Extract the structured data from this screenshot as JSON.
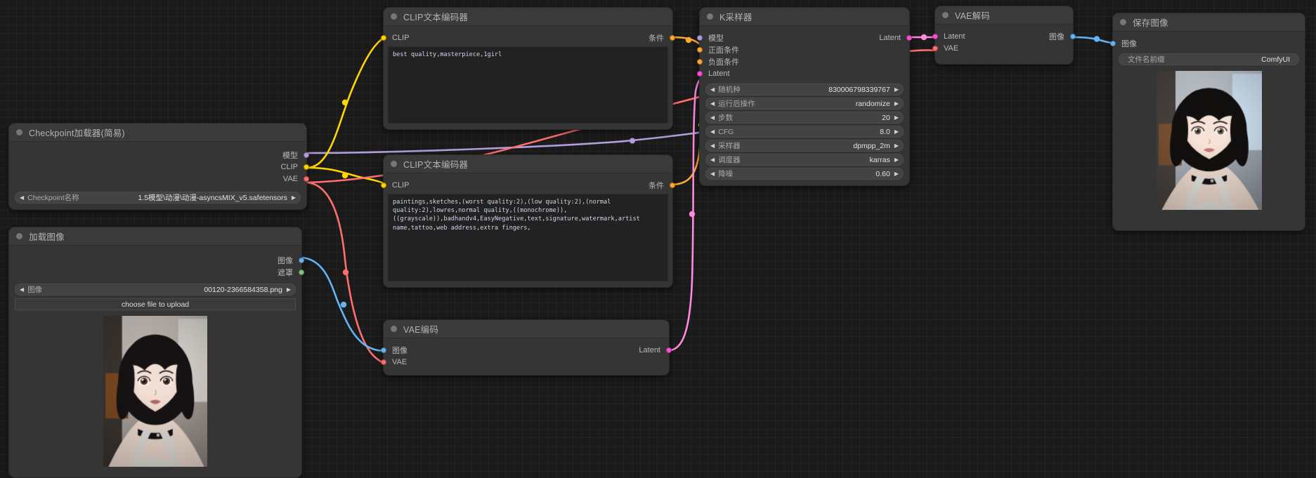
{
  "app": {
    "name": "ComfyUI",
    "canvas_background": "#1a1a1a"
  },
  "colors": {
    "model": "#b39ddb",
    "clip": "#ffd500",
    "vae": "#ff6e6e",
    "conditioning": "#ffa931",
    "latent": "#ff4fd8",
    "image": "#64b5f6",
    "mask": "#81c784"
  },
  "nodes": {
    "checkpoint_loader": {
      "title": "Checkpoint加载器(简易)",
      "outputs": [
        {
          "label": "模型",
          "type": "model"
        },
        {
          "label": "CLIP",
          "type": "clip"
        },
        {
          "label": "VAE",
          "type": "vae"
        }
      ],
      "widgets": [
        {
          "name": "Checkpoint名称",
          "value": "1.5模型\\动漫\\动漫-asyncsMIX_v5.safetensors"
        }
      ]
    },
    "load_image": {
      "title": "加载图像",
      "outputs": [
        {
          "label": "图像",
          "type": "image"
        },
        {
          "label": "遮罩",
          "type": "mask"
        }
      ],
      "widgets": [
        {
          "name": "图像",
          "value": "00120-2366584358.png"
        }
      ],
      "button": "choose file to upload"
    },
    "clip_positive": {
      "title": "CLIP文本编码器",
      "inputs": [
        {
          "label": "CLIP",
          "type": "clip"
        }
      ],
      "outputs": [
        {
          "label": "条件",
          "type": "conditioning"
        }
      ],
      "text": "best quality,masterpiece,1girl"
    },
    "clip_negative": {
      "title": "CLIP文本编码器",
      "inputs": [
        {
          "label": "CLIP",
          "type": "clip"
        }
      ],
      "outputs": [
        {
          "label": "条件",
          "type": "conditioning"
        }
      ],
      "text": "paintings,sketches,(worst quality:2),(low quality:2),(normal\nquality:2),lowres,normal quality,((monochrome)),\n((grayscale)),badhandv4,EasyNegative,text,signature,watermark,artist\nname,tattoo,web address,extra fingers,"
    },
    "vae_encode": {
      "title": "VAE编码",
      "inputs": [
        {
          "label": "图像",
          "type": "image"
        },
        {
          "label": "VAE",
          "type": "vae"
        }
      ],
      "outputs": [
        {
          "label": "Latent",
          "type": "latent"
        }
      ]
    },
    "ksampler": {
      "title": "K采样器",
      "inputs": [
        {
          "label": "模型",
          "type": "model"
        },
        {
          "label": "正面条件",
          "type": "conditioning"
        },
        {
          "label": "负面条件",
          "type": "conditioning"
        },
        {
          "label": "Latent",
          "type": "latent"
        }
      ],
      "outputs": [
        {
          "label": "Latent",
          "type": "latent"
        }
      ],
      "widgets": [
        {
          "name": "随机种",
          "value": "830006798339767"
        },
        {
          "name": "运行后操作",
          "value": "randomize"
        },
        {
          "name": "步数",
          "value": "20"
        },
        {
          "name": "CFG",
          "value": "8.0"
        },
        {
          "name": "采样器",
          "value": "dpmpp_2m"
        },
        {
          "name": "调度器",
          "value": "karras"
        },
        {
          "name": "降噪",
          "value": "0.60"
        }
      ]
    },
    "vae_decode": {
      "title": "VAE解码",
      "inputs": [
        {
          "label": "Latent",
          "type": "latent"
        },
        {
          "label": "VAE",
          "type": "vae"
        }
      ],
      "outputs": [
        {
          "label": "图像",
          "type": "image"
        }
      ]
    },
    "save_image": {
      "title": "保存图像",
      "inputs": [
        {
          "label": "图像",
          "type": "image"
        }
      ],
      "widgets": [
        {
          "name": "文件名前缀",
          "value": "ComfyUI"
        }
      ]
    }
  },
  "icons": {
    "collapse": "circle-icon",
    "arrow_left": "chevron-left-icon",
    "arrow_right": "chevron-right-icon"
  }
}
